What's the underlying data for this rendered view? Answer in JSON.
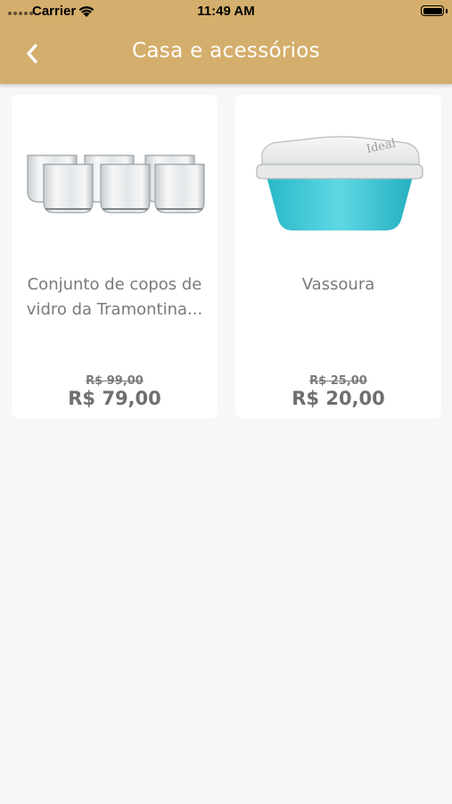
{
  "status_bar": {
    "carrier": "Carrier",
    "time": "11:49 AM"
  },
  "header": {
    "title": "Casa e acessórios",
    "back_icon": "chevron-left-icon",
    "background_color": "#d4ae6c"
  },
  "products": [
    {
      "name": "Conjunto de copos de vidro da Tramontina...",
      "old_price": "R$ 99,00",
      "price": "R$ 79,00",
      "image_icon": "glasses-set-image"
    },
    {
      "name": "Vassoura",
      "old_price": "R$ 25,00",
      "price": "R$ 20,00",
      "image_icon": "food-container-image",
      "image_brand_text": "Ideal"
    }
  ]
}
